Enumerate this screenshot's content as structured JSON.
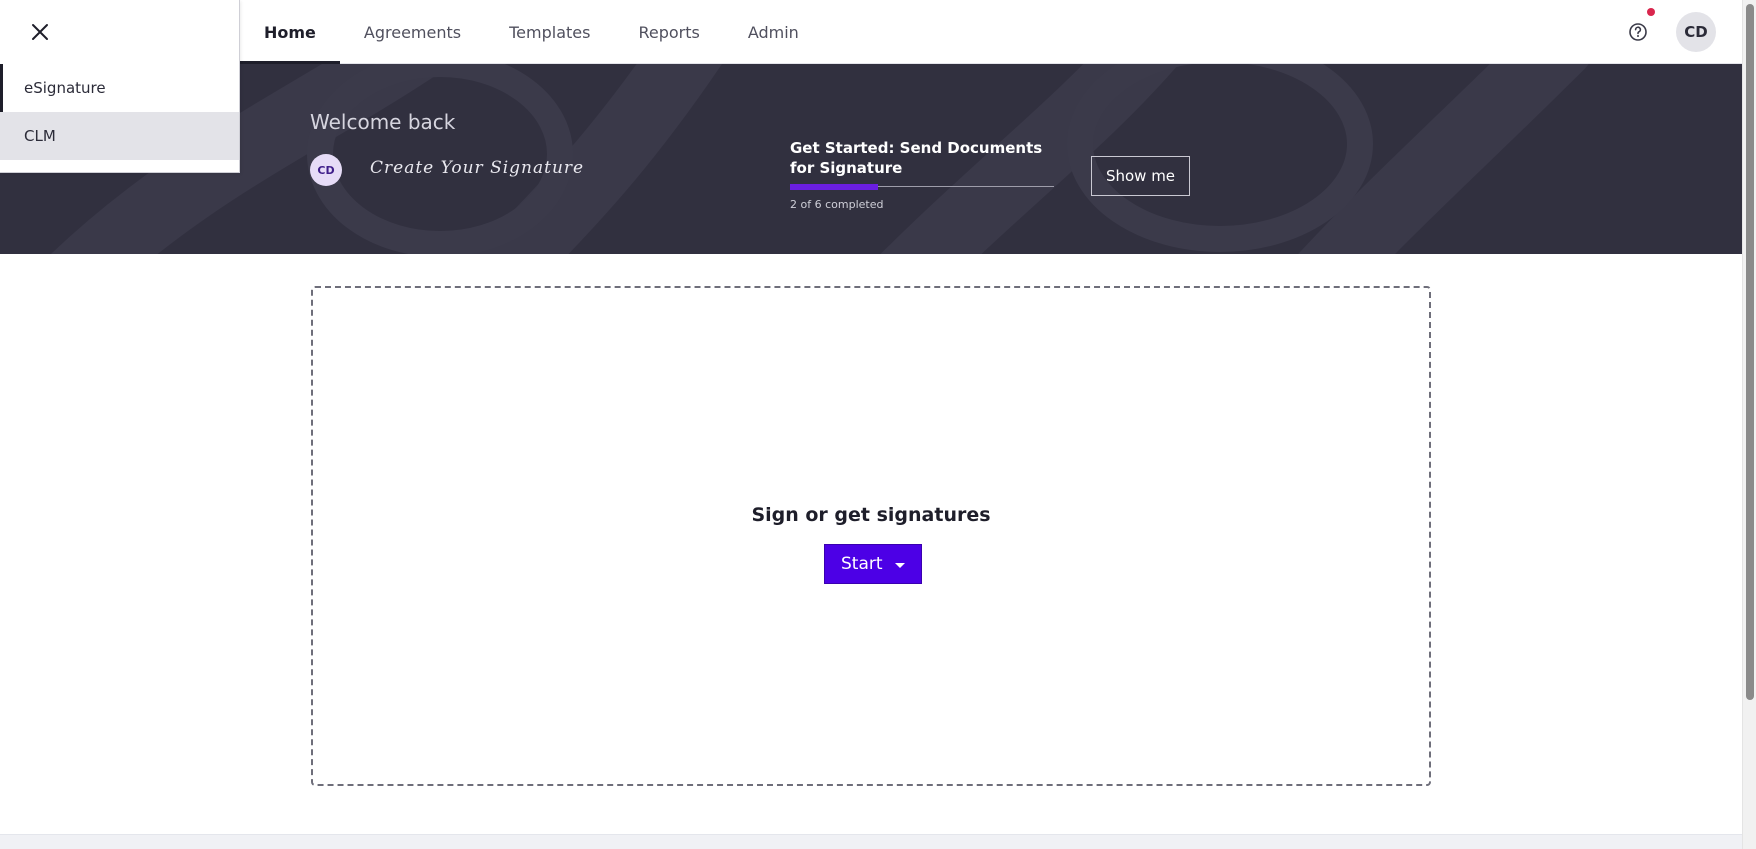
{
  "nav": {
    "tabs": [
      {
        "label": "Home"
      },
      {
        "label": "Agreements"
      },
      {
        "label": "Templates"
      },
      {
        "label": "Reports"
      },
      {
        "label": "Admin"
      }
    ],
    "active_tab": "Home",
    "user_initials": "CD"
  },
  "app_menu": {
    "items": [
      {
        "label": "eSignature"
      },
      {
        "label": "CLM"
      }
    ]
  },
  "hero": {
    "welcome": "Welcome back",
    "avatar_initials": "CD",
    "create_signature": "Create Your Signature",
    "get_started_title": "Get Started: Send Documents for Signature",
    "progress_completed": 2,
    "progress_total": 6,
    "progress_text": "2 of 6 completed",
    "show_me_label": "Show me"
  },
  "main": {
    "sign_title": "Sign or get signatures",
    "start_label": "Start"
  },
  "colors": {
    "hero_bg": "#31303f",
    "accent": "#4c00e6",
    "progress_fill": "#6a1ee0",
    "notification": "#d9264d"
  },
  "icons": {
    "close": "close-icon",
    "help": "help-circle-icon",
    "caret": "caret-down-icon"
  }
}
